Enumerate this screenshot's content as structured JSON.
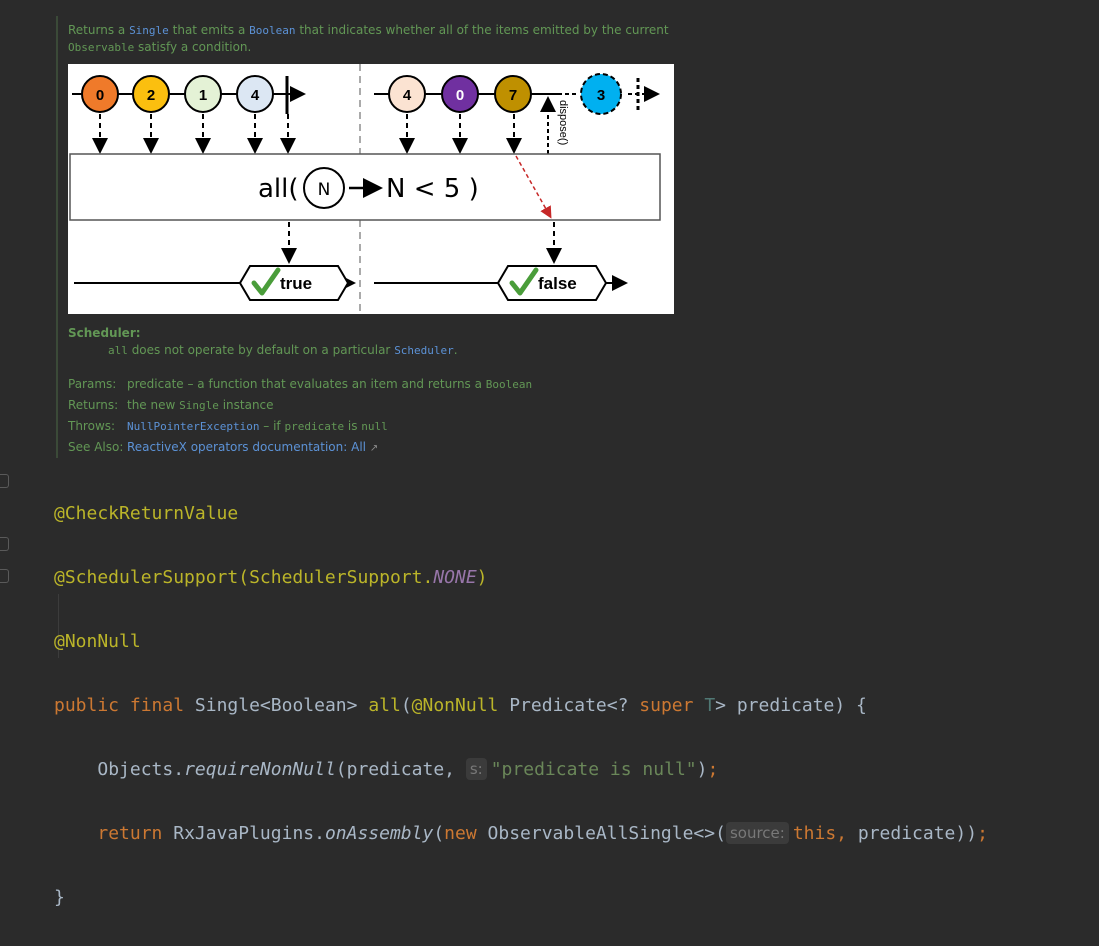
{
  "doc": {
    "desc_1": "Returns a ",
    "desc_single": "Single",
    "desc_2": " that emits a ",
    "desc_boolean": "Boolean",
    "desc_3": " that indicates whether all of the items emitted by the current ",
    "desc_observable": "Observable",
    "desc_4": " satisfy a condition.",
    "diagram": {
      "left_items": [
        "0",
        "2",
        "1",
        "4"
      ],
      "right_items": [
        "4",
        "0",
        "7",
        "3"
      ],
      "operator_prefix": "all(",
      "operator_var": "N",
      "operator_suffix": "N < 5 )",
      "dispose_label": "dispose()",
      "result_left": "true",
      "result_right": "false"
    },
    "scheduler_title": "Scheduler:",
    "scheduler_code": "all",
    "scheduler_text": " does not operate by default on a particular ",
    "scheduler_link": "Scheduler",
    "scheduler_end": ".",
    "params_label": "Params:",
    "params_name": "predicate",
    "params_text": " – a function that evaluates an item and returns a ",
    "params_type": "Boolean",
    "returns_label": "Returns:",
    "returns_text_1": "the new ",
    "returns_code": "Single",
    "returns_text_2": " instance",
    "throws_label": "Throws:",
    "throws_link": "NullPointerException",
    "throws_text": " – if ",
    "throws_code_1": "predicate",
    "throws_text_2": " is ",
    "throws_code_2": "null",
    "seealso_label": "See Also:",
    "seealso_link": "ReactiveX operators documentation: All",
    "seealso_icon": "↗"
  },
  "code": {
    "ann_check": "@CheckReturnValue",
    "ann_sched": "@SchedulerSupport",
    "ann_sched_arg_1": "(SchedulerSupport.",
    "ann_sched_const": "NONE",
    "ann_sched_arg_2": ")",
    "ann_nonnull": "@NonNull",
    "l4_public": "public",
    "l4_final": "final",
    "l4_ret": "Single<Boolean>",
    "l4_name": "all",
    "l4_paren": "(",
    "l4_ann": "@NonNull",
    "l4_type1": "Predicate<?",
    "l4_super": "super",
    "l4_T": "T",
    "l4_type2": ">",
    "l4_param": "predicate) {",
    "l5_obj": "Objects.",
    "l5_method": "requireNonNull",
    "l5_arg": "(predicate,",
    "l5_hint": "s:",
    "l5_str": "\"predicate is null\"",
    "l5_end1": ")",
    "l5_semi": ";",
    "l6_return": "return",
    "l6_cls": "RxJavaPlugins.",
    "l6_method": "onAssembly",
    "l6_paren": "(",
    "l6_new": "new",
    "l6_type": "ObservableAllSingle<>(",
    "l6_hint": "source:",
    "l6_this": "this,",
    "l6_rest": "predicate))",
    "l6_semi": ";",
    "l7": "}"
  },
  "colors": {
    "background": "#2b2b2b",
    "doc_text": "#629755",
    "link": "#5c92d6",
    "annotation": "#bbb529",
    "keyword": "#cc7832",
    "default_text": "#a9b7c6",
    "string": "#6a8759",
    "constant": "#9876aa"
  }
}
